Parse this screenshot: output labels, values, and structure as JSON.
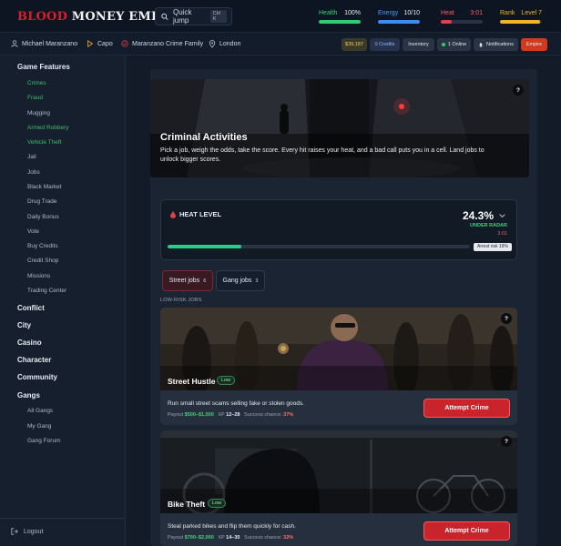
{
  "brand": {
    "part1": "BLOOD",
    "part2": "MONEY EMPIRE"
  },
  "quick_jump": {
    "label": "Quick jump",
    "shortcut": "Ctrl K"
  },
  "stats": {
    "health": {
      "label": "Health",
      "value": "100%",
      "fraction": 1.0,
      "color": "#2ecc71"
    },
    "energy": {
      "label": "Energy",
      "value": "10/10",
      "fraction": 1.0,
      "color": "#3b8df0"
    },
    "heat": {
      "label": "Heat",
      "value": "3:01",
      "fraction": 0.25,
      "color": "#e0404a"
    },
    "rank": {
      "label": "Rank",
      "value": "Level 7",
      "fraction": 0.95,
      "color": "#f0b323"
    }
  },
  "profile": {
    "name": "Michael Maranzano",
    "role": "Capo",
    "family": "Maranzano Crime Family",
    "city": "London"
  },
  "pills": {
    "money": "$39,187",
    "credits": "0 Credits",
    "inventory": "Inventory",
    "online": "1 Online",
    "notifications": "Notifications",
    "empire": "Empire"
  },
  "sidebar": {
    "game_features": "Game Features",
    "items": [
      "Crimes",
      "Fraud",
      "Mugging",
      "Armed Robbery",
      "Vehicle Theft",
      "Jail",
      "Jobs",
      "Black Market",
      "Drug Trade",
      "Daily Bonus",
      "Vote",
      "Buy Credits",
      "Credit Shop",
      "Missions",
      "Trading Center"
    ],
    "conflict": "Conflict",
    "city": "City",
    "casino": "Casino",
    "character": "Character",
    "community": "Community",
    "gangs": "Gangs",
    "gang_items": [
      "All Gangs",
      "My Gang",
      "Gang Forum"
    ],
    "logout": "Logout"
  },
  "hero": {
    "title": "Criminal Activities",
    "text": "Pick a job, weigh the odds, take the score. Every hit raises your heat, and a bad call puts you in a cell. Land jobs to unlock bigger scores."
  },
  "heat": {
    "label": "HEAT LEVEL",
    "percent": "24.3%",
    "status": "UNDER RADAR",
    "timer": "3:01",
    "fraction": 0.243,
    "arrest": "Arrest risk 19%"
  },
  "tabs": [
    {
      "label": "Street jobs",
      "count": "6"
    },
    {
      "label": "Gang jobs",
      "count": "3"
    }
  ],
  "section_label": "LOW-RISK JOBS",
  "jobs": [
    {
      "title": "Street Hustle",
      "risk": "Low",
      "desc": "Run small street scams selling fake or stolen goods.",
      "payout_label": "Payout",
      "payout": "$500–$1,500",
      "xp_label": "XP",
      "xp": "12–28",
      "chance_label": "Success chance:",
      "chance": "37%",
      "button": "Attempt Crime"
    },
    {
      "title": "Bike Theft",
      "risk": "Low",
      "desc": "Steal parked bikes and flip them quickly for cash.",
      "payout_label": "Payout",
      "payout": "$700–$2,000",
      "xp_label": "XP",
      "xp": "14–30",
      "chance_label": "Success chance:",
      "chance": "32%",
      "button": "Attempt Crime"
    }
  ]
}
